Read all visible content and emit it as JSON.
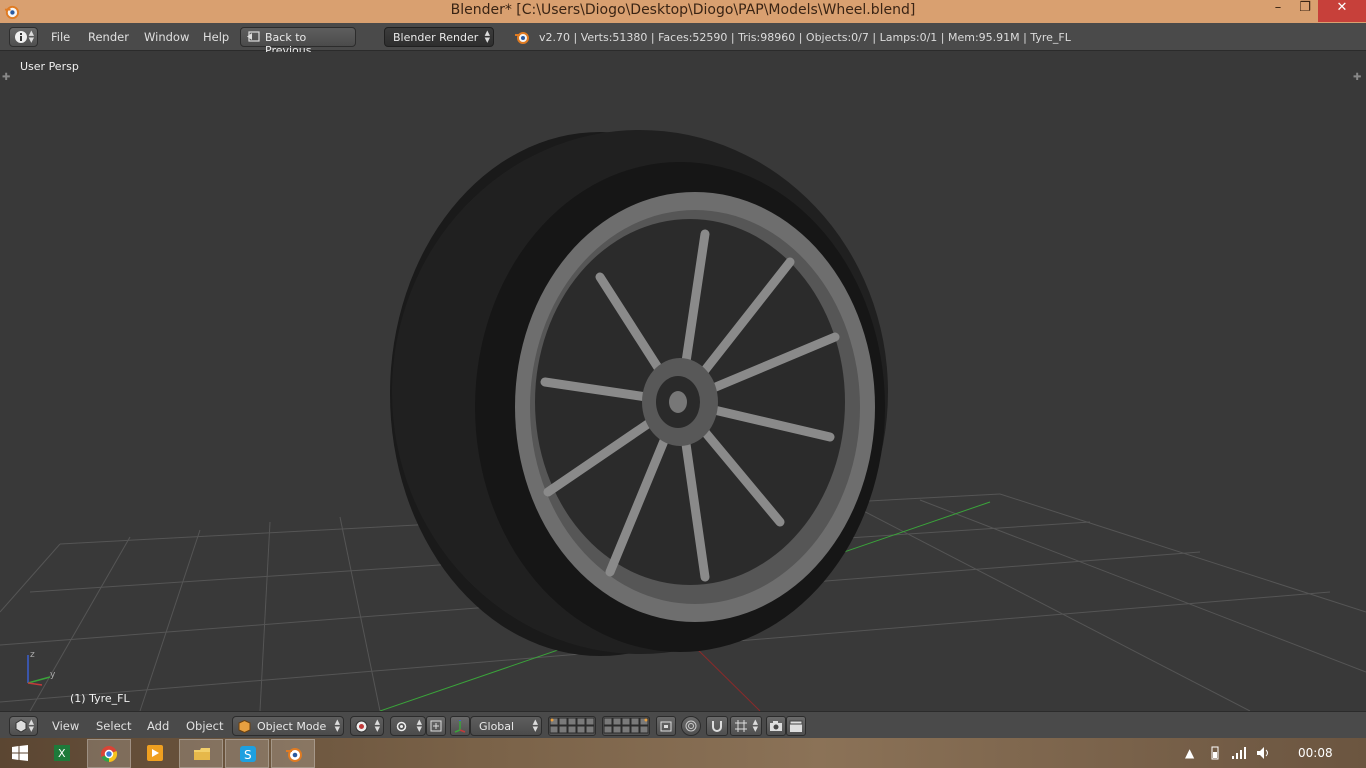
{
  "window": {
    "title": "Blender* [C:\\Users\\Diogo\\Desktop\\Diogo\\PAP\\Models\\Wheel.blend]",
    "minimize": "–",
    "maximize": "❐",
    "close": "✕"
  },
  "info_header": {
    "menus": [
      "File",
      "Render",
      "Window",
      "Help"
    ],
    "back_button": "Back to Previous",
    "render_engine": "Blender Render",
    "stats": "v2.70 | Verts:51380 | Faces:52590 | Tris:98960 | Objects:0/7 | Lamps:0/1 | Mem:95.91M | Tyre_FL"
  },
  "viewport": {
    "view_name": "User Persp",
    "active_object": "(1) Tyre_FL",
    "axis_labels": {
      "z": "z",
      "y": "y"
    }
  },
  "view3d_header": {
    "menus": [
      "View",
      "Select",
      "Add",
      "Object"
    ],
    "mode": "Object Mode",
    "orientation": "Global"
  },
  "taskbar": {
    "clock": "00:08",
    "apps": [
      "start-icon",
      "excel-icon",
      "chrome-icon",
      "media-player-icon",
      "file-explorer-icon",
      "skype-icon",
      "blender-icon"
    ]
  },
  "colors": {
    "title_bar": "#d9a070",
    "close_button": "#c7403a",
    "header_bg": "#4a4a4a",
    "viewport_bg": "#393939",
    "grid": "#555555",
    "x_axis": "#8a2a2a",
    "y_axis": "#3aa33a"
  }
}
